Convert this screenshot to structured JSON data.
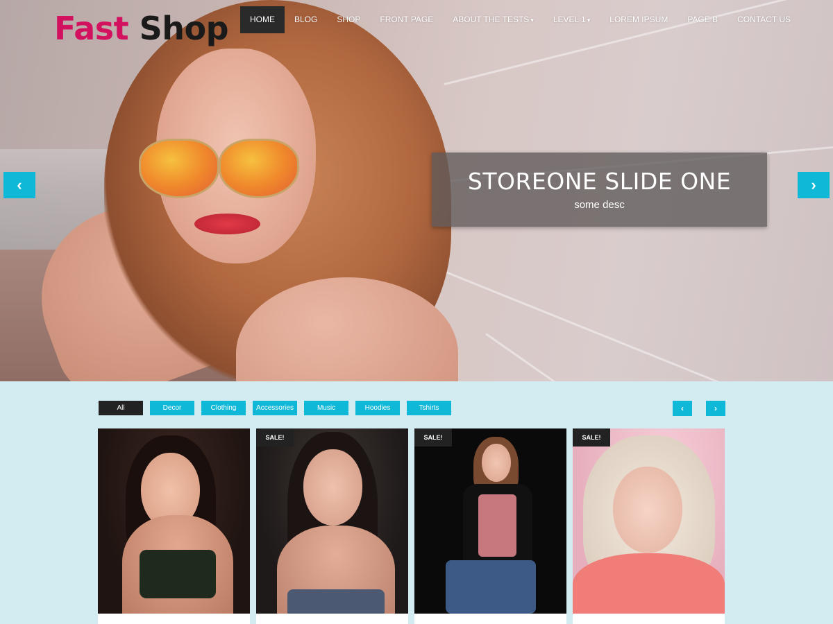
{
  "site": {
    "logo_part1": "Fast",
    "logo_part2": "Shop"
  },
  "nav": {
    "items": [
      {
        "label": "HOME",
        "active": true,
        "dropdown": false
      },
      {
        "label": "BLOG",
        "active": false,
        "dropdown": false
      },
      {
        "label": "SHOP",
        "active": false,
        "dropdown": false
      },
      {
        "label": "FRONT PAGE",
        "active": false,
        "dropdown": false
      },
      {
        "label": "ABOUT THE TESTS",
        "active": false,
        "dropdown": true
      },
      {
        "label": "LEVEL 1",
        "active": false,
        "dropdown": true
      },
      {
        "label": "LOREM IPSUM",
        "active": false,
        "dropdown": false
      },
      {
        "label": "PAGE B",
        "active": false,
        "dropdown": false
      },
      {
        "label": "CONTACT US",
        "active": false,
        "dropdown": false
      }
    ],
    "caret": "▾"
  },
  "slider": {
    "title": "STOREONE SLIDE ONE",
    "description": "some desc",
    "prev_icon": "‹",
    "next_icon": "›"
  },
  "products": {
    "filters": [
      {
        "label": "All",
        "active": true
      },
      {
        "label": "Decor",
        "active": false
      },
      {
        "label": "Clothing",
        "active": false
      },
      {
        "label": "Accessories",
        "active": false
      },
      {
        "label": "Music",
        "active": false
      },
      {
        "label": "Hoodies",
        "active": false
      },
      {
        "label": "Tshirts",
        "active": false
      }
    ],
    "prev_icon": "‹",
    "next_icon": "›",
    "sale_badge": "SALE!",
    "cards": [
      {
        "sale": false
      },
      {
        "sale": true
      },
      {
        "sale": true
      },
      {
        "sale": true
      }
    ]
  },
  "colors": {
    "accent": "#0fb8d6",
    "logo_pink": "#d2125e",
    "dark": "#222222",
    "section_bg": "#d3ecf1"
  },
  "icons": {
    "slider_prev": "chevron-left-icon",
    "slider_next": "chevron-right-icon",
    "dropdown": "caret-down-icon"
  }
}
